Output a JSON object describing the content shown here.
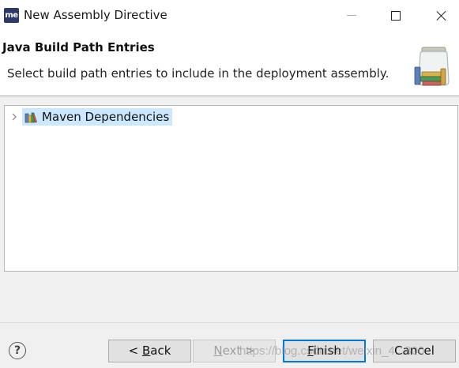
{
  "window": {
    "app_icon_text": "me",
    "title": "New Assembly Directive"
  },
  "header": {
    "title": "Java Build Path Entries",
    "description": "Select build path entries to include in the deployment assembly."
  },
  "tree": {
    "items": [
      {
        "label": "Maven Dependencies",
        "icon": "library-icon",
        "expanded": false,
        "selected": true
      }
    ]
  },
  "buttons": {
    "help": "?",
    "back": {
      "mnemonic": "B",
      "rest": "ack",
      "prefix": "< "
    },
    "next": {
      "mnemonic": "N",
      "rest": "ext >"
    },
    "finish": {
      "mnemonic": "F",
      "rest": "inish"
    },
    "cancel": "Cancel"
  },
  "watermark": "https://blog.csdn.net/weixin_4...300",
  "colors": {
    "selection": "#cce8ff",
    "default_button_border": "#0078d7",
    "app_icon_bg": "#2b3a67"
  }
}
